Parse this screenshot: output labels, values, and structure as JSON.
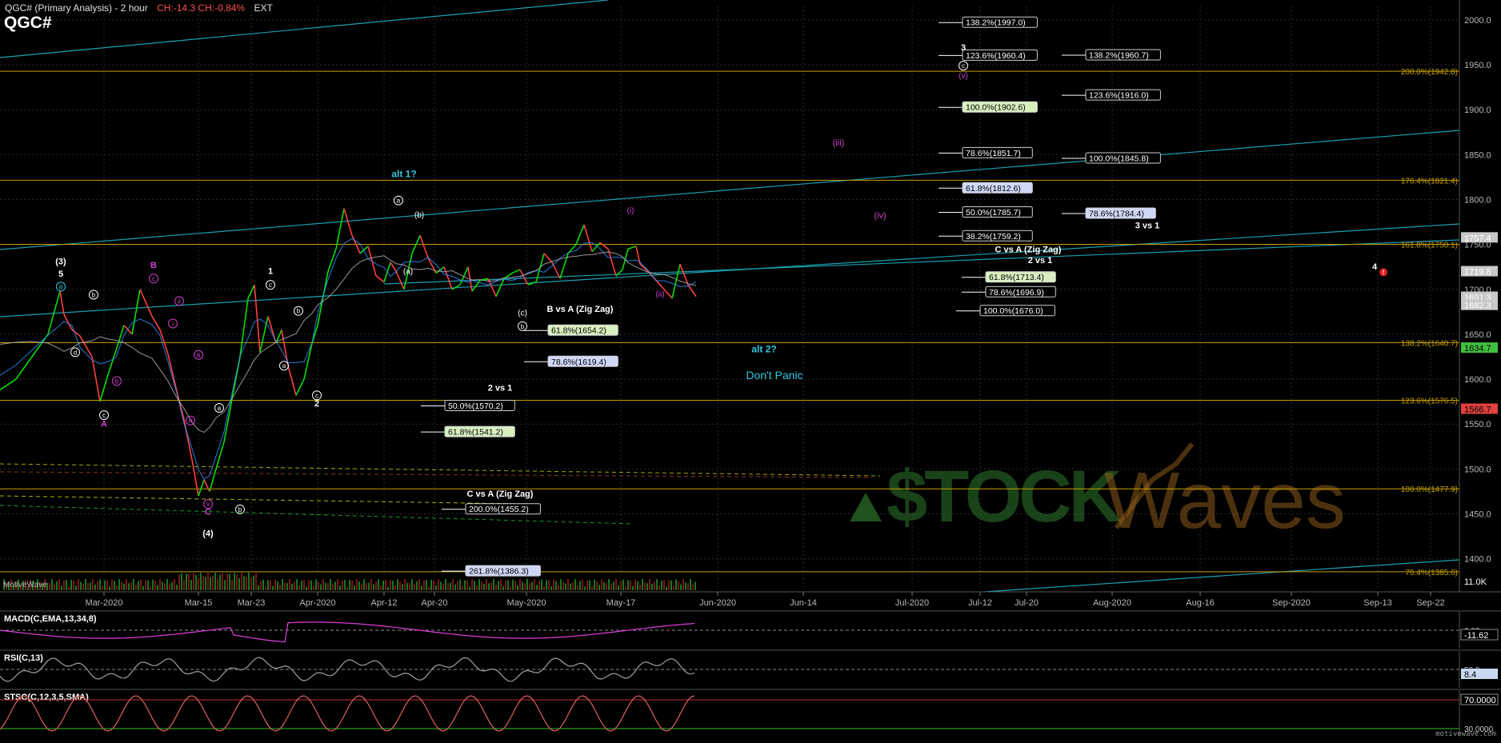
{
  "header": {
    "title": "QGC# (Primary Analysis) - 2 hour",
    "change": "CH:-14.3  CH:-0.84%",
    "session": "EXT",
    "symbol": "QGC#"
  },
  "colors": {
    "background": "#000000",
    "price_up": "#00e000",
    "price_down": "#ff4040",
    "fib_line": "#c8a000",
    "trend_line": "#1aa0b0",
    "label_white": "#ffffff",
    "label_magenta": "#d040d0",
    "label_cyan": "#30c8e0",
    "axis_text": "#b8b8b8",
    "watermark": "#2a6e2a"
  },
  "chart_data": {
    "type": "line",
    "title": "QGC# (Primary Analysis) - 2 hour",
    "y_range": [
      1365,
      2015
    ],
    "x_range": [
      0,
      1824
    ],
    "grid": true,
    "y_ticks": [
      1400,
      1450,
      1500,
      1550,
      1600,
      1650,
      1700,
      1750,
      1800,
      1850,
      1900,
      1950,
      2000
    ],
    "y_tick_labels": [
      "1400.0",
      "1450.0",
      "1500.0",
      "1550.0",
      "1600.0",
      "1650.0",
      "1700.0",
      "1750.0",
      "1800.0",
      "1850.0",
      "1900.0",
      "1950.0",
      "2000.0"
    ],
    "x_ticks": [
      {
        "label": "Mar-2020",
        "x": 130
      },
      {
        "label": "Mar-15",
        "x": 248
      },
      {
        "label": "Mar-23",
        "x": 314
      },
      {
        "label": "Apr-2020",
        "x": 397
      },
      {
        "label": "Apr-12",
        "x": 480
      },
      {
        "label": "Apr-20",
        "x": 543
      },
      {
        "label": "May-2020",
        "x": 658
      },
      {
        "label": "May-17",
        "x": 776
      },
      {
        "label": "Jun-2020",
        "x": 897
      },
      {
        "label": "Jun-14",
        "x": 1004
      },
      {
        "label": "Jul-2020",
        "x": 1140
      },
      {
        "label": "Jul-12",
        "x": 1225
      },
      {
        "label": "Jul-20",
        "x": 1283
      },
      {
        "label": "Aug-2020",
        "x": 1390
      },
      {
        "label": "Aug-16",
        "x": 1500
      },
      {
        "label": "Sep-2020",
        "x": 1614
      },
      {
        "label": "Sep-13",
        "x": 1722
      },
      {
        "label": "Sep-22",
        "x": 1788
      }
    ],
    "price_series": {
      "name": "QGC#",
      "x": [
        0,
        20,
        40,
        60,
        75,
        80,
        90,
        100,
        115,
        125,
        135,
        145,
        155,
        165,
        175,
        190,
        200,
        210,
        220,
        230,
        240,
        248,
        255,
        262,
        270,
        280,
        290,
        300,
        310,
        318,
        325,
        335,
        345,
        352,
        360,
        370,
        380,
        390,
        397,
        410,
        420,
        430,
        440,
        450,
        460,
        470,
        480,
        488,
        495,
        505,
        515,
        525,
        535,
        545,
        555,
        565,
        575,
        585,
        590,
        600,
        610,
        620,
        630,
        640,
        650,
        660,
        670,
        680,
        690,
        700,
        710,
        720,
        730,
        740,
        750,
        760,
        770,
        778,
        785,
        795,
        800,
        810,
        820,
        830,
        840,
        850,
        860,
        870
      ],
      "y": [
        1588,
        1600,
        1625,
        1650,
        1698,
        1672,
        1655,
        1648,
        1625,
        1575,
        1605,
        1632,
        1660,
        1650,
        1700,
        1670,
        1655,
        1628,
        1590,
        1555,
        1510,
        1470,
        1488,
        1475,
        1500,
        1530,
        1578,
        1625,
        1690,
        1705,
        1630,
        1670,
        1640,
        1655,
        1615,
        1582,
        1600,
        1640,
        1660,
        1720,
        1745,
        1790,
        1760,
        1740,
        1748,
        1715,
        1708,
        1730,
        1720,
        1700,
        1740,
        1760,
        1735,
        1718,
        1725,
        1700,
        1705,
        1725,
        1698,
        1710,
        1712,
        1692,
        1712,
        1718,
        1722,
        1705,
        1708,
        1740,
        1730,
        1712,
        1740,
        1750,
        1772,
        1742,
        1752,
        1745,
        1715,
        1722,
        1745,
        1748,
        1728,
        1720,
        1710,
        1700,
        1690,
        1728,
        1705,
        1692
      ]
    },
    "fib_levels": [
      {
        "value": 1942.8,
        "label": "200.0%(1942.8)"
      },
      {
        "value": 1821.4,
        "label": "176.4%(1821.4)"
      },
      {
        "value": 1750.1,
        "label": "161.8%(1750.1)"
      },
      {
        "value": 1640.7,
        "label": "138.2%(1640.7)"
      },
      {
        "value": 1576.5,
        "label": "123.6%(1576.5)"
      },
      {
        "value": 1477.9,
        "label": "100.0%(1477.9)"
      },
      {
        "value": 1385.6,
        "label": "76.4%(1385.6)"
      }
    ],
    "price_tags": [
      {
        "value": 1757.4,
        "label": "1757.4",
        "color": "#ffffff",
        "bg": "#c8c8c8"
      },
      {
        "value": 1719.8,
        "label": "1719.8",
        "color": "#ffffff",
        "bg": "#c8c8c8"
      },
      {
        "value": 1691.3,
        "label": "1691.3",
        "color": "#ffffff",
        "bg": "#c8c8c8"
      },
      {
        "value": 1682.3,
        "label": "1682.3",
        "color": "#ffffff",
        "bg": "#c8c8c8"
      },
      {
        "value": 1634.7,
        "label": "1634.7",
        "color": "#000000",
        "bg": "#40c040"
      },
      {
        "value": 1566.7,
        "label": "1566.7",
        "color": "#000000",
        "bg": "#e04040"
      },
      {
        "value": 1375.0,
        "label": "11.0K",
        "color": "#ffffff",
        "bg": "#000000"
      }
    ],
    "boxes": [
      {
        "label": "138.2%(1997.0)",
        "x": 1203,
        "value": 1997.0,
        "bg": "#000000",
        "fg": "#ffffff"
      },
      {
        "label": "123.6%(1960.4)",
        "x": 1203,
        "value": 1960.4,
        "bg": "#000000",
        "fg": "#ffffff"
      },
      {
        "label": "138.2%(1960.7)",
        "x": 1357,
        "value": 1960.7,
        "bg": "#000000",
        "fg": "#ffffff"
      },
      {
        "label": "123.6%(1916.0)",
        "x": 1357,
        "value": 1916.0,
        "bg": "#000000",
        "fg": "#ffffff"
      },
      {
        "label": "100.0%(1902.6)",
        "x": 1203,
        "value": 1902.6,
        "bg": "#d8f0c0",
        "fg": "#000000"
      },
      {
        "label": "78.6%(1851.7)",
        "x": 1203,
        "value": 1851.7,
        "bg": "#000000",
        "fg": "#ffffff"
      },
      {
        "label": "100.0%(1845.8)",
        "x": 1357,
        "value": 1845.8,
        "bg": "#000000",
        "fg": "#ffffff"
      },
      {
        "label": "61.8%(1812.6)",
        "x": 1203,
        "value": 1812.6,
        "bg": "#d0d8f8",
        "fg": "#000000"
      },
      {
        "label": "50.0%(1785.7)",
        "x": 1203,
        "value": 1785.7,
        "bg": "#000000",
        "fg": "#ffffff"
      },
      {
        "label": "78.6%(1784.4)",
        "x": 1357,
        "value": 1784.4,
        "bg": "#d0d8f8",
        "fg": "#000000"
      },
      {
        "label": "38.2%(1759.2)",
        "x": 1203,
        "value": 1759.2,
        "bg": "#000000",
        "fg": "#ffffff"
      },
      {
        "label": "61.8%(1713.4)",
        "x": 1232,
        "value": 1713.4,
        "bg": "#d8f0c0",
        "fg": "#000000"
      },
      {
        "label": "78.6%(1696.9)",
        "x": 1232,
        "value": 1696.9,
        "bg": "#000000",
        "fg": "#ffffff"
      },
      {
        "label": "100.0%(1676.0)",
        "x": 1225,
        "value": 1676.0,
        "bg": "#000000",
        "fg": "#ffffff"
      },
      {
        "label": "61.8%(1654.2)",
        "x": 685,
        "value": 1654.2,
        "bg": "#d8f0c0",
        "fg": "#000000"
      },
      {
        "label": "78.6%(1619.4)",
        "x": 685,
        "value": 1619.4,
        "bg": "#d0d8f8",
        "fg": "#000000"
      },
      {
        "label": "50.0%(1570.2)",
        "x": 556,
        "value": 1570.2,
        "bg": "#000000",
        "fg": "#ffffff"
      },
      {
        "label": "61.8%(1541.2)",
        "x": 556,
        "value": 1541.2,
        "bg": "#d8f0c0",
        "fg": "#000000"
      },
      {
        "label": "200.0%(1455.2)",
        "x": 582,
        "value": 1455.2,
        "bg": "#000000",
        "fg": "#ffffff"
      },
      {
        "label": "261.8%(1386.3)",
        "x": 582,
        "value": 1386.3,
        "bg": "#d0d8f8",
        "fg": "#000000"
      }
    ],
    "annotations": [
      {
        "text": "alt 1?",
        "x": 505,
        "value": 1825,
        "color": "#30c8e0",
        "size": 12,
        "bold": true
      },
      {
        "text": "alt 2?",
        "x": 955,
        "value": 1630,
        "color": "#30c8e0",
        "size": 12,
        "bold": true
      },
      {
        "text": "Don't Panic",
        "x": 968,
        "value": 1600,
        "color": "#30c8e0",
        "size": 14,
        "bold": false
      },
      {
        "text": "B vs A (Zig Zag)",
        "x": 725,
        "value": 1675,
        "color": "#ffffff",
        "size": 11,
        "bold": true
      },
      {
        "text": "2 vs 1",
        "x": 625,
        "value": 1587,
        "color": "#ffffff",
        "size": 11,
        "bold": true
      },
      {
        "text": "C vs A (Zig Zag)",
        "x": 625,
        "value": 1469,
        "color": "#ffffff",
        "size": 11,
        "bold": true
      },
      {
        "text": "C vs A (Zig Zag)",
        "x": 1285,
        "value": 1741,
        "color": "#ffffff",
        "size": 11,
        "bold": true
      },
      {
        "text": "2 vs 1",
        "x": 1300,
        "value": 1729,
        "color": "#ffffff",
        "size": 11,
        "bold": true
      },
      {
        "text": "3 vs 1",
        "x": 1434,
        "value": 1768,
        "color": "#ffffff",
        "size": 11,
        "bold": true
      },
      {
        "text": "(iii)",
        "x": 1048,
        "value": 1860,
        "color": "#d040d0",
        "size": 11,
        "bold": false
      },
      {
        "text": "(iv)",
        "x": 1100,
        "value": 1779,
        "color": "#d040d0",
        "size": 11,
        "bold": false
      },
      {
        "text": "(3)",
        "x": 76,
        "value": 1728,
        "color": "#ffffff",
        "size": 11,
        "bold": true
      },
      {
        "text": "5",
        "x": 76,
        "value": 1714,
        "color": "#ffffff",
        "size": 11,
        "bold": true
      },
      {
        "text": "B",
        "x": 192,
        "value": 1724,
        "color": "#d040d0",
        "size": 11,
        "bold": true
      },
      {
        "text": "A",
        "x": 130,
        "value": 1547,
        "color": "#d040d0",
        "size": 11,
        "bold": true
      },
      {
        "text": "C",
        "x": 260,
        "value": 1449,
        "color": "#d040d0",
        "size": 11,
        "bold": true
      },
      {
        "text": "(4)",
        "x": 260,
        "value": 1425,
        "color": "#ffffff",
        "size": 11,
        "bold": true
      },
      {
        "text": "1",
        "x": 338,
        "value": 1717,
        "color": "#ffffff",
        "size": 11,
        "bold": true
      },
      {
        "text": "2",
        "x": 396,
        "value": 1570,
        "color": "#ffffff",
        "size": 11,
        "bold": true
      },
      {
        "text": "(a)",
        "x": 510,
        "value": 1717,
        "color": "#ffffff",
        "size": 10,
        "bold": false
      },
      {
        "text": "(b)",
        "x": 524,
        "value": 1780,
        "color": "#ffffff",
        "size": 10,
        "bold": false
      },
      {
        "text": "(c)",
        "x": 653,
        "value": 1671,
        "color": "#ffffff",
        "size": 10,
        "bold": false
      },
      {
        "text": "(i)",
        "x": 788,
        "value": 1785,
        "color": "#d040d0",
        "size": 10,
        "bold": false
      },
      {
        "text": "(ii)",
        "x": 825,
        "value": 1692,
        "color": "#d040d0",
        "size": 10,
        "bold": false
      },
      {
        "text": "3",
        "x": 1204,
        "value": 1966,
        "color": "#ffffff",
        "size": 11,
        "bold": true
      },
      {
        "text": "(v)",
        "x": 1204,
        "value": 1935,
        "color": "#d040d0",
        "size": 10,
        "bold": false
      },
      {
        "text": "4",
        "x": 1718,
        "value": 1722,
        "color": "#ffffff",
        "size": 11,
        "bold": true
      }
    ],
    "circled_labels": [
      {
        "text": "iii",
        "x": 76,
        "value": 1703,
        "color": "#30c8e0"
      },
      {
        "text": "b",
        "x": 117,
        "value": 1694,
        "color": "#ffffff"
      },
      {
        "text": "d",
        "x": 94,
        "value": 1630,
        "color": "#ffffff"
      },
      {
        "text": "c",
        "x": 130,
        "value": 1560,
        "color": "#ffffff"
      },
      {
        "text": "c",
        "x": 192,
        "value": 1712,
        "color": "#d040d0"
      },
      {
        "text": "ii",
        "x": 224,
        "value": 1687,
        "color": "#d040d0"
      },
      {
        "text": "i",
        "x": 216,
        "value": 1662,
        "color": "#d040d0"
      },
      {
        "text": "iii",
        "x": 248,
        "value": 1627,
        "color": "#d040d0"
      },
      {
        "text": "iii",
        "x": 238,
        "value": 1554,
        "color": "#d040d0"
      },
      {
        "text": "a",
        "x": 274,
        "value": 1568,
        "color": "#ffffff"
      },
      {
        "text": "v",
        "x": 260,
        "value": 1461,
        "color": "#d040d0"
      },
      {
        "text": "b",
        "x": 300,
        "value": 1455,
        "color": "#ffffff"
      },
      {
        "text": "c",
        "x": 338,
        "value": 1705,
        "color": "#ffffff"
      },
      {
        "text": "b",
        "x": 373,
        "value": 1676,
        "color": "#ffffff"
      },
      {
        "text": "a",
        "x": 355,
        "value": 1615,
        "color": "#ffffff"
      },
      {
        "text": "c",
        "x": 396,
        "value": 1582,
        "color": "#ffffff"
      },
      {
        "text": "a",
        "x": 498,
        "value": 1799,
        "color": "#ffffff"
      },
      {
        "text": "b",
        "x": 653,
        "value": 1659,
        "color": "#ffffff"
      },
      {
        "text": "c",
        "x": 1204,
        "value": 1949,
        "color": "#ffffff"
      },
      {
        "text": "b",
        "x": 146,
        "value": 1598,
        "color": "#d040d0"
      }
    ],
    "watermark": {
      "text": "StockWaves"
    }
  },
  "indicators": [
    {
      "name": "MACD(C,EMA,13,34,8)",
      "value_label": "-11.62",
      "levels": [
        "0.00"
      ]
    },
    {
      "name": "RSI(C,13)",
      "value_label": "8.4",
      "levels": [
        "50.0"
      ]
    },
    {
      "name": "STSC(C,12,3,5,SMA)",
      "value_label": "70.0000",
      "levels": [
        "70.0000",
        "30.0000"
      ]
    }
  ],
  "branding": {
    "left_label": "MotiveWave",
    "bottom_right": "motivewave.com"
  }
}
